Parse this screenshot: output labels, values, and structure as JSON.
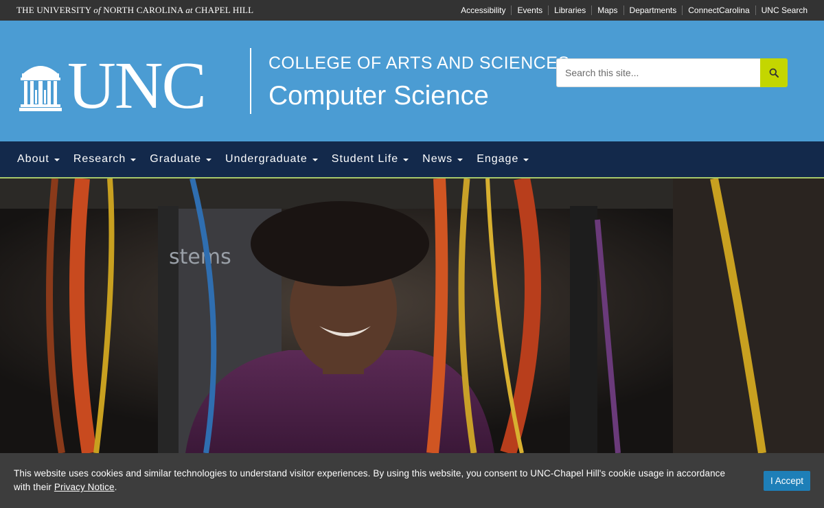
{
  "topbar": {
    "wordmark": {
      "part1": "THE UNIVERSITY ",
      "of": "of",
      "part2": " NORTH CAROLINA ",
      "at": "at",
      "part3": " CHAPEL HILL"
    },
    "links": [
      "Accessibility",
      "Events",
      "Libraries",
      "Maps",
      "Departments",
      "ConnectCarolina",
      "UNC Search"
    ]
  },
  "header": {
    "logo_text": "UNC",
    "college": "COLLEGE OF ARTS AND SCIENCES",
    "department": "Computer Science",
    "search_placeholder": "Search this site...",
    "search_icon": "search-icon"
  },
  "nav": {
    "items": [
      "About",
      "Research",
      "Graduate",
      "Undergraduate",
      "Student Life",
      "News",
      "Engage"
    ]
  },
  "hero": {
    "sign_text": "stems"
  },
  "cookie": {
    "text_before": "This website uses cookies and similar technologies to understand visitor experiences. By using this website, you consent to UNC-Chapel Hill's cookie usage in accordance with their ",
    "link": "Privacy Notice",
    "text_after": ".",
    "accept": "I Accept"
  },
  "colors": {
    "carolina_blue": "#4b9cd3",
    "navy": "#13294b",
    "search_button": "#c4d600",
    "accept_button": "#1e7fb8"
  }
}
